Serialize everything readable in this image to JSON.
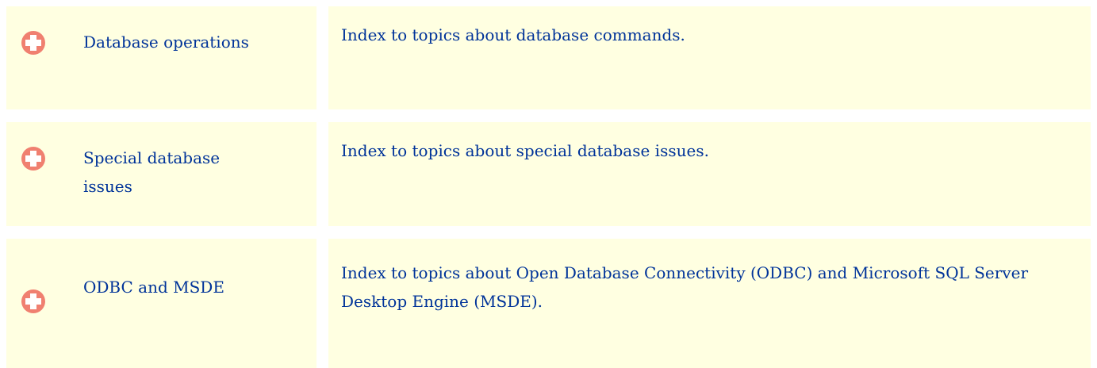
{
  "colors": {
    "cell_background": "#ffffe1",
    "text": "#003399",
    "icon_fill": "#f08070",
    "icon_cross": "#ffffff"
  },
  "rows": [
    {
      "icon": "expand-plus-icon",
      "link_label": "Database operations",
      "description": "Index to topics about database commands."
    },
    {
      "icon": "expand-plus-icon",
      "link_label": "Special database issues",
      "description": "Index to topics about special database issues."
    },
    {
      "icon": "expand-plus-icon",
      "link_label": "ODBC and MSDE",
      "description": "Index to topics about Open Database Connectivity (ODBC) and Microsoft SQL Server Desktop Engine (MSDE)."
    }
  ]
}
